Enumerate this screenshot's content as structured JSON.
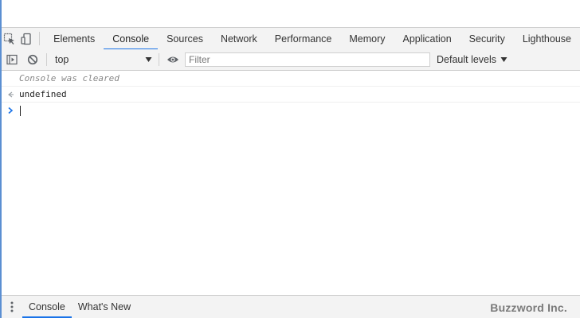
{
  "tabbar": {
    "icons": [
      "inspect-element-icon",
      "device-toolbar-icon"
    ],
    "tabs": [
      {
        "label": "Elements",
        "active": false
      },
      {
        "label": "Console",
        "active": true
      },
      {
        "label": "Sources",
        "active": false
      },
      {
        "label": "Network",
        "active": false
      },
      {
        "label": "Performance",
        "active": false
      },
      {
        "label": "Memory",
        "active": false
      },
      {
        "label": "Application",
        "active": false
      },
      {
        "label": "Security",
        "active": false
      },
      {
        "label": "Lighthouse",
        "active": false
      }
    ]
  },
  "console_toolbar": {
    "icons": [
      "sidebar-toggle-icon",
      "clear-console-icon",
      "eye-icon"
    ],
    "context": "top",
    "filter_placeholder": "Filter",
    "levels": "Default levels"
  },
  "messages": [
    {
      "type": "cleared",
      "text": "Console was cleared"
    },
    {
      "type": "result",
      "icon": "result-arrow-icon",
      "text": "undefined"
    }
  ],
  "prompt": {
    "icon": "prompt-chevron-icon"
  },
  "drawer": {
    "icons": [
      "drawer-menu-icon"
    ],
    "tabs": [
      {
        "label": "Console",
        "active": true
      },
      {
        "label": "What's New",
        "active": false
      }
    ]
  },
  "watermark": "Buzzword Inc.",
  "colors": {
    "accent": "#1a73e8",
    "frame": "#5b8fd2",
    "toolbar_bg": "#f3f3f3",
    "prompt": "#1a73e8"
  }
}
